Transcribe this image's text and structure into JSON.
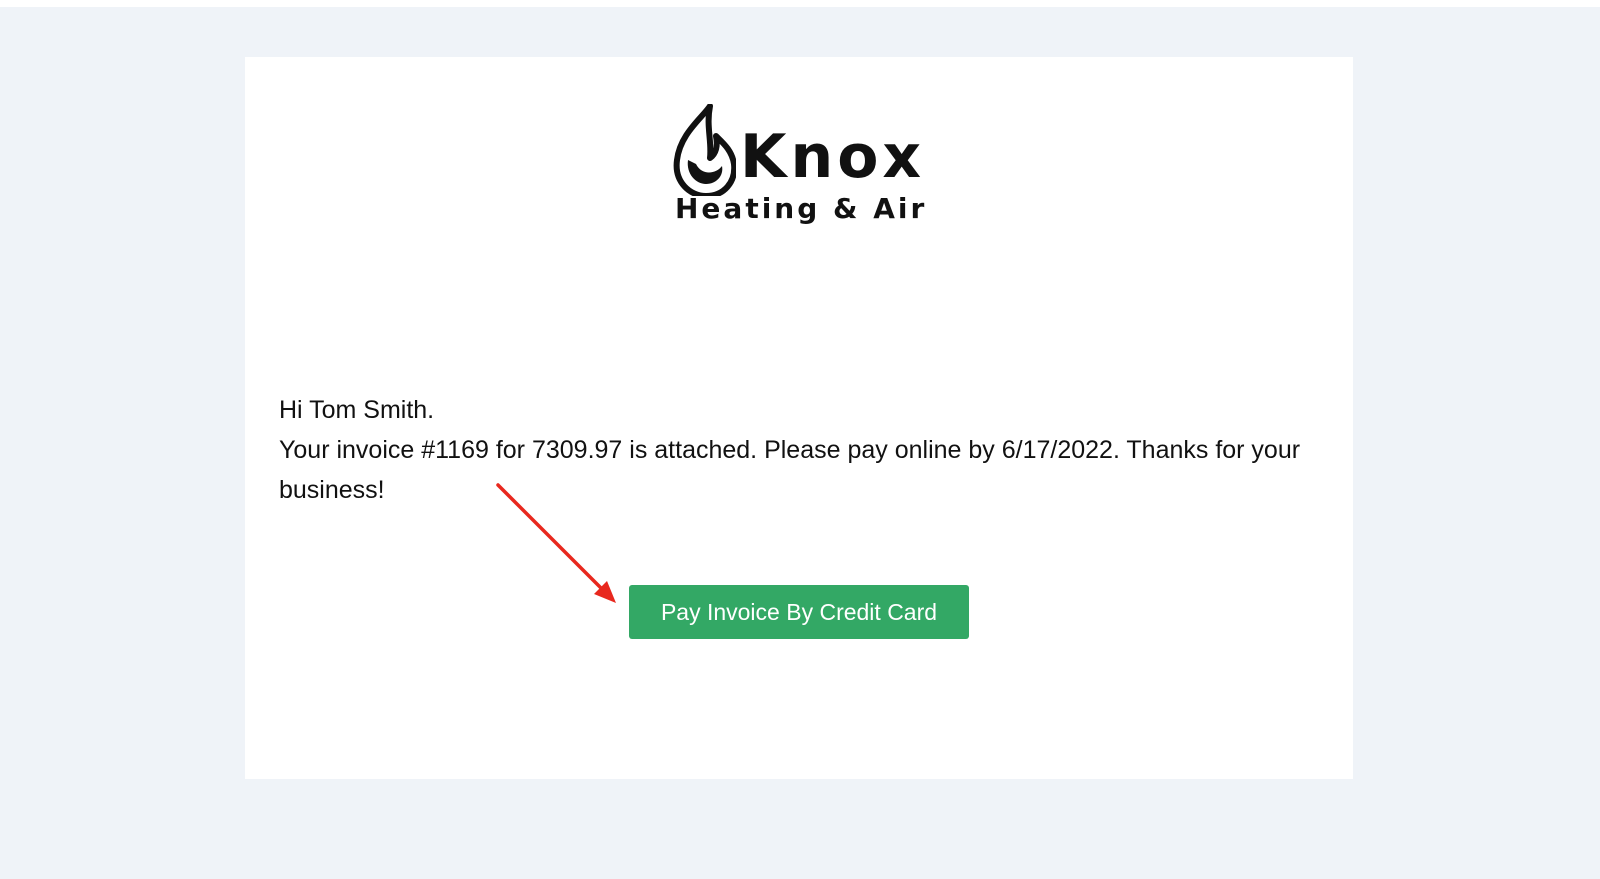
{
  "logo": {
    "name": "Knox",
    "tagline": "Heating & Air",
    "icon": "flame-icon"
  },
  "message": {
    "greeting": "Hi Tom Smith.",
    "body": "Your invoice #1169 for 7309.97 is attached. Please pay online by 6/17/2022. Thanks for your business!"
  },
  "pay_button": {
    "label": "Pay Invoice By Credit Card",
    "color": "#33a865"
  },
  "annotation": {
    "icon": "arrow-icon",
    "color": "#e8281e"
  },
  "colors": {
    "page_background": "#eff3f8",
    "card_background": "#ffffff",
    "text": "#111111"
  }
}
